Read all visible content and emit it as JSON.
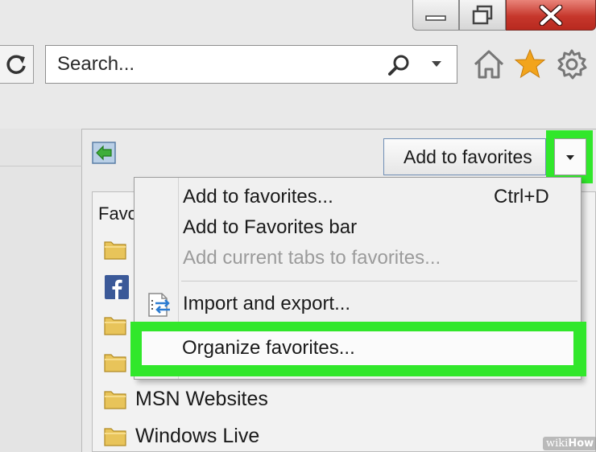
{
  "search": {
    "placeholder": "Search..."
  },
  "favorites_pane": {
    "add_button_label": "Add to favorites",
    "list_header_partial": "Favo",
    "rows": [
      {
        "icon": "folder-icon",
        "label": ""
      },
      {
        "icon": "facebook-icon",
        "label": ""
      },
      {
        "icon": "folder-icon",
        "label": ""
      },
      {
        "icon": "folder-icon",
        "label": ""
      },
      {
        "icon": "folder-icon",
        "label": "MSN Websites"
      },
      {
        "icon": "folder-icon",
        "label": "Windows Live"
      }
    ]
  },
  "menu": {
    "items": [
      {
        "label": "Add to favorites...",
        "shortcut": "Ctrl+D",
        "enabled": true
      },
      {
        "label": "Add to Favorites bar",
        "shortcut": "",
        "enabled": true
      },
      {
        "label": "Add current tabs to favorites...",
        "shortcut": "",
        "enabled": false
      },
      {
        "label": "Import and export...",
        "shortcut": "",
        "enabled": true,
        "icon": "import-export-icon"
      },
      {
        "label": "Organize favorites...",
        "shortcut": "",
        "enabled": true,
        "highlighted": true
      }
    ]
  },
  "colors": {
    "highlight": "#31e72b",
    "close_button": "#c6372c",
    "star": "#f2a41c"
  },
  "watermark": {
    "prefix": "wiki",
    "suffix": "How"
  }
}
